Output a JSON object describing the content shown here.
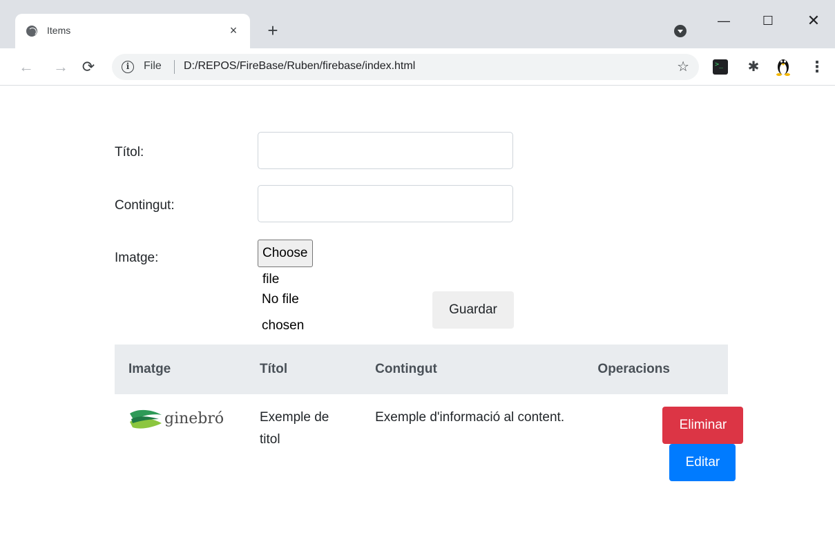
{
  "browser": {
    "tab_title": "Items",
    "tab_close": "×",
    "new_tab": "+",
    "window": {
      "minimize": "—",
      "maximize": "☐",
      "close": "✕"
    },
    "nav": {
      "back": "←",
      "forward": "→",
      "reload": "C"
    },
    "address": {
      "scheme": "File",
      "url": "D:/REPOS/FireBase/Ruben/firebase/index.html",
      "info": "i",
      "bookmark": "☆"
    },
    "extensions": {
      "puzzle": "✱",
      "menu": "⋮"
    }
  },
  "form": {
    "title_label": "Títol:",
    "title_value": "",
    "content_label": "Contingut:",
    "content_value": "",
    "image_label": "Imatge:",
    "file_button": "Choose file",
    "file_status": "No file chosen",
    "save_button": "Guardar"
  },
  "table": {
    "headers": [
      "Imatge",
      "Títol",
      "Contingut",
      "Operacions"
    ],
    "rows": [
      {
        "image_logo_text": "ginebró",
        "title": "Exemple de titol",
        "content": "Exemple d'informació al content.",
        "delete_button": "Eliminar",
        "edit_button": "Editar"
      }
    ]
  },
  "colors": {
    "danger": "#dc3545",
    "primary": "#007bff",
    "table_header_bg": "#e9ecef",
    "logo_green": "#3aa35b"
  }
}
